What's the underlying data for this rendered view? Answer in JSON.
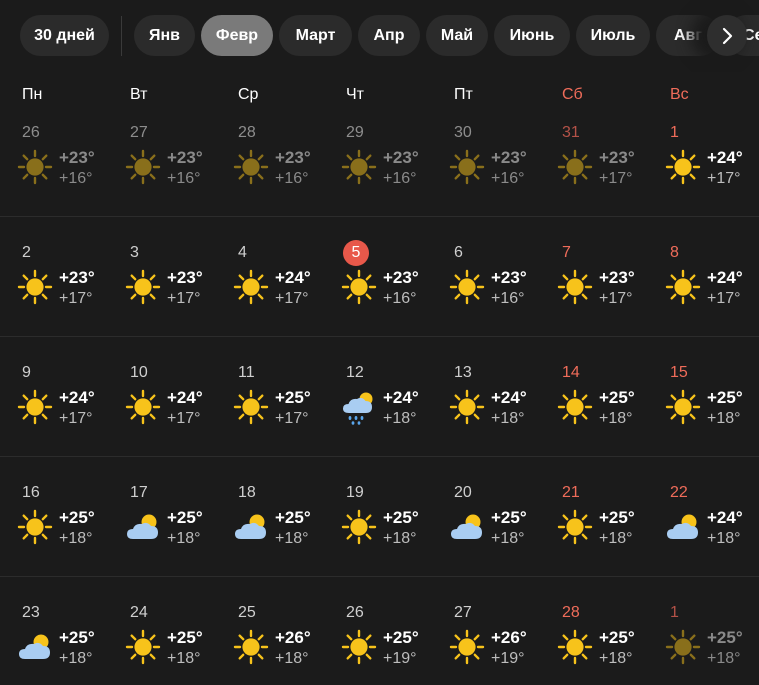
{
  "tabs": [
    {
      "label": "30 дней",
      "active": false
    },
    {
      "label": "Янв",
      "active": false
    },
    {
      "label": "Февр",
      "active": true
    },
    {
      "label": "Март",
      "active": false
    },
    {
      "label": "Апр",
      "active": false
    },
    {
      "label": "Май",
      "active": false
    },
    {
      "label": "Июнь",
      "active": false
    },
    {
      "label": "Июль",
      "active": false
    },
    {
      "label": "Авг",
      "active": false
    },
    {
      "label": "Сент",
      "active": false
    }
  ],
  "weekdays": [
    "Пн",
    "Вт",
    "Ср",
    "Чт",
    "Пт",
    "Сб",
    "Вс"
  ],
  "colors": {
    "weekend": "#ef6c5a",
    "today_badge": "#e8584a",
    "active_tab": "#7a7a7a",
    "sun": "#f7c31b"
  },
  "weeks": [
    [
      {
        "day": "26",
        "high": "+23°",
        "low": "+16°",
        "icon": "sun-icon",
        "other_month": true
      },
      {
        "day": "27",
        "high": "+23°",
        "low": "+16°",
        "icon": "sun-icon",
        "other_month": true
      },
      {
        "day": "28",
        "high": "+23°",
        "low": "+16°",
        "icon": "sun-icon",
        "other_month": true
      },
      {
        "day": "29",
        "high": "+23°",
        "low": "+16°",
        "icon": "sun-icon",
        "other_month": true
      },
      {
        "day": "30",
        "high": "+23°",
        "low": "+16°",
        "icon": "sun-icon",
        "other_month": true
      },
      {
        "day": "31",
        "high": "+23°",
        "low": "+17°",
        "icon": "sun-icon",
        "other_month": true
      },
      {
        "day": "1",
        "high": "+24°",
        "low": "+17°",
        "icon": "sun-icon",
        "other_month": false
      }
    ],
    [
      {
        "day": "2",
        "high": "+23°",
        "low": "+17°",
        "icon": "sun-icon"
      },
      {
        "day": "3",
        "high": "+23°",
        "low": "+17°",
        "icon": "sun-icon"
      },
      {
        "day": "4",
        "high": "+24°",
        "low": "+17°",
        "icon": "sun-icon"
      },
      {
        "day": "5",
        "high": "+23°",
        "low": "+16°",
        "icon": "sun-icon",
        "today": true
      },
      {
        "day": "6",
        "high": "+23°",
        "low": "+16°",
        "icon": "sun-icon"
      },
      {
        "day": "7",
        "high": "+23°",
        "low": "+17°",
        "icon": "sun-icon"
      },
      {
        "day": "8",
        "high": "+24°",
        "low": "+17°",
        "icon": "sun-icon"
      }
    ],
    [
      {
        "day": "9",
        "high": "+24°",
        "low": "+17°",
        "icon": "sun-icon"
      },
      {
        "day": "10",
        "high": "+24°",
        "low": "+17°",
        "icon": "sun-icon"
      },
      {
        "day": "11",
        "high": "+25°",
        "low": "+17°",
        "icon": "sun-icon"
      },
      {
        "day": "12",
        "high": "+24°",
        "low": "+18°",
        "icon": "rain-cloud-sun-icon"
      },
      {
        "day": "13",
        "high": "+24°",
        "low": "+18°",
        "icon": "sun-icon"
      },
      {
        "day": "14",
        "high": "+25°",
        "low": "+18°",
        "icon": "sun-icon"
      },
      {
        "day": "15",
        "high": "+25°",
        "low": "+18°",
        "icon": "sun-icon"
      }
    ],
    [
      {
        "day": "16",
        "high": "+25°",
        "low": "+18°",
        "icon": "sun-icon"
      },
      {
        "day": "17",
        "high": "+25°",
        "low": "+18°",
        "icon": "partly-cloudy-icon"
      },
      {
        "day": "18",
        "high": "+25°",
        "low": "+18°",
        "icon": "partly-cloudy-icon"
      },
      {
        "day": "19",
        "high": "+25°",
        "low": "+18°",
        "icon": "sun-icon"
      },
      {
        "day": "20",
        "high": "+25°",
        "low": "+18°",
        "icon": "partly-cloudy-icon"
      },
      {
        "day": "21",
        "high": "+25°",
        "low": "+18°",
        "icon": "sun-icon"
      },
      {
        "day": "22",
        "high": "+24°",
        "low": "+18°",
        "icon": "partly-cloudy-icon"
      }
    ],
    [
      {
        "day": "23",
        "high": "+25°",
        "low": "+18°",
        "icon": "partly-cloudy-icon"
      },
      {
        "day": "24",
        "high": "+25°",
        "low": "+18°",
        "icon": "sun-icon"
      },
      {
        "day": "25",
        "high": "+26°",
        "low": "+18°",
        "icon": "sun-icon"
      },
      {
        "day": "26",
        "high": "+25°",
        "low": "+19°",
        "icon": "sun-icon"
      },
      {
        "day": "27",
        "high": "+26°",
        "low": "+19°",
        "icon": "sun-icon"
      },
      {
        "day": "28",
        "high": "+25°",
        "low": "+18°",
        "icon": "sun-icon"
      },
      {
        "day": "1",
        "high": "+25°",
        "low": "+18°",
        "icon": "sun-icon",
        "other_month": true
      }
    ]
  ]
}
